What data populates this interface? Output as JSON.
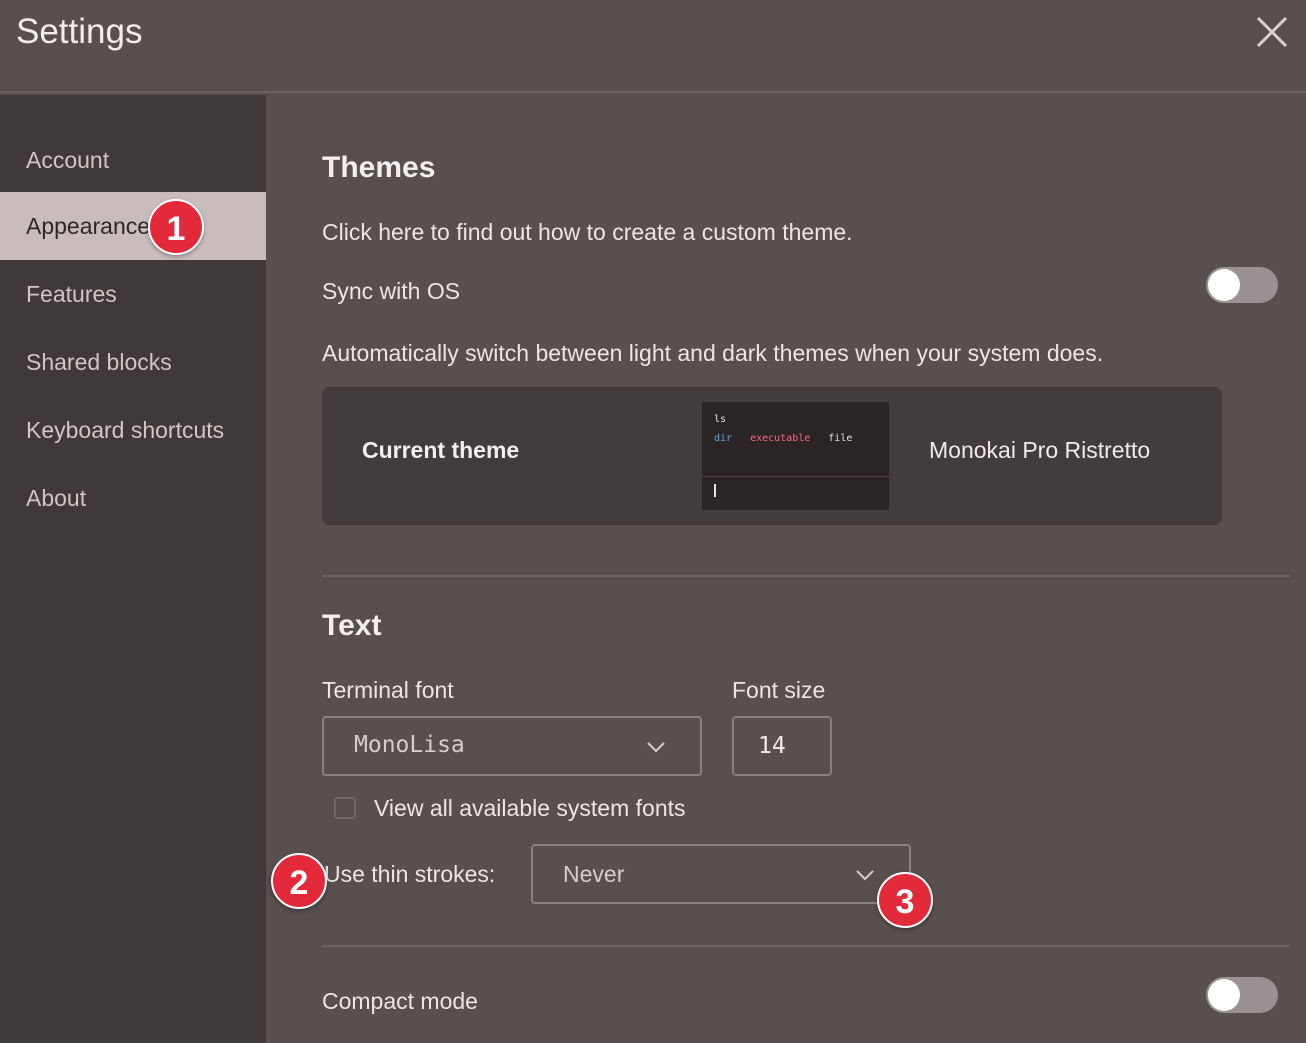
{
  "window": {
    "title": "Settings"
  },
  "sidebar": {
    "items": [
      {
        "label": "Account"
      },
      {
        "label": "Appearance"
      },
      {
        "label": "Features"
      },
      {
        "label": "Shared blocks"
      },
      {
        "label": "Keyboard shortcuts"
      },
      {
        "label": "About"
      }
    ],
    "active": "Appearance"
  },
  "themes": {
    "heading": "Themes",
    "custom_link": "Click here to find out how to create a custom theme.",
    "sync_label": "Sync with OS",
    "sync_on": false,
    "sync_description": "Automatically switch between light and dark themes when your system does.",
    "current_label": "Current theme",
    "current_name": "Monokai Pro Ristretto",
    "preview": {
      "command": "ls",
      "dir": "dir",
      "executable": "executable",
      "file": "file",
      "colors": {
        "dir": "#5aa9e6",
        "executable": "#fd6883",
        "file": "#e6e0e0"
      }
    }
  },
  "text": {
    "heading": "Text",
    "terminal_font_label": "Terminal font",
    "terminal_font_value": "MonoLisa",
    "font_size_label": "Font size",
    "font_size_value": "14",
    "system_fonts_label": "View all available system fonts",
    "system_fonts_checked": false,
    "thin_strokes_label": "Use thin strokes:",
    "thin_strokes_value": "Never"
  },
  "compact": {
    "label": "Compact mode",
    "on": false
  },
  "badges": [
    "1",
    "2",
    "3"
  ],
  "colors": {
    "badge": "#e32a3a",
    "active_nav": "#c9bcbc",
    "background": "#584f4f",
    "sidebar": "#403939"
  }
}
